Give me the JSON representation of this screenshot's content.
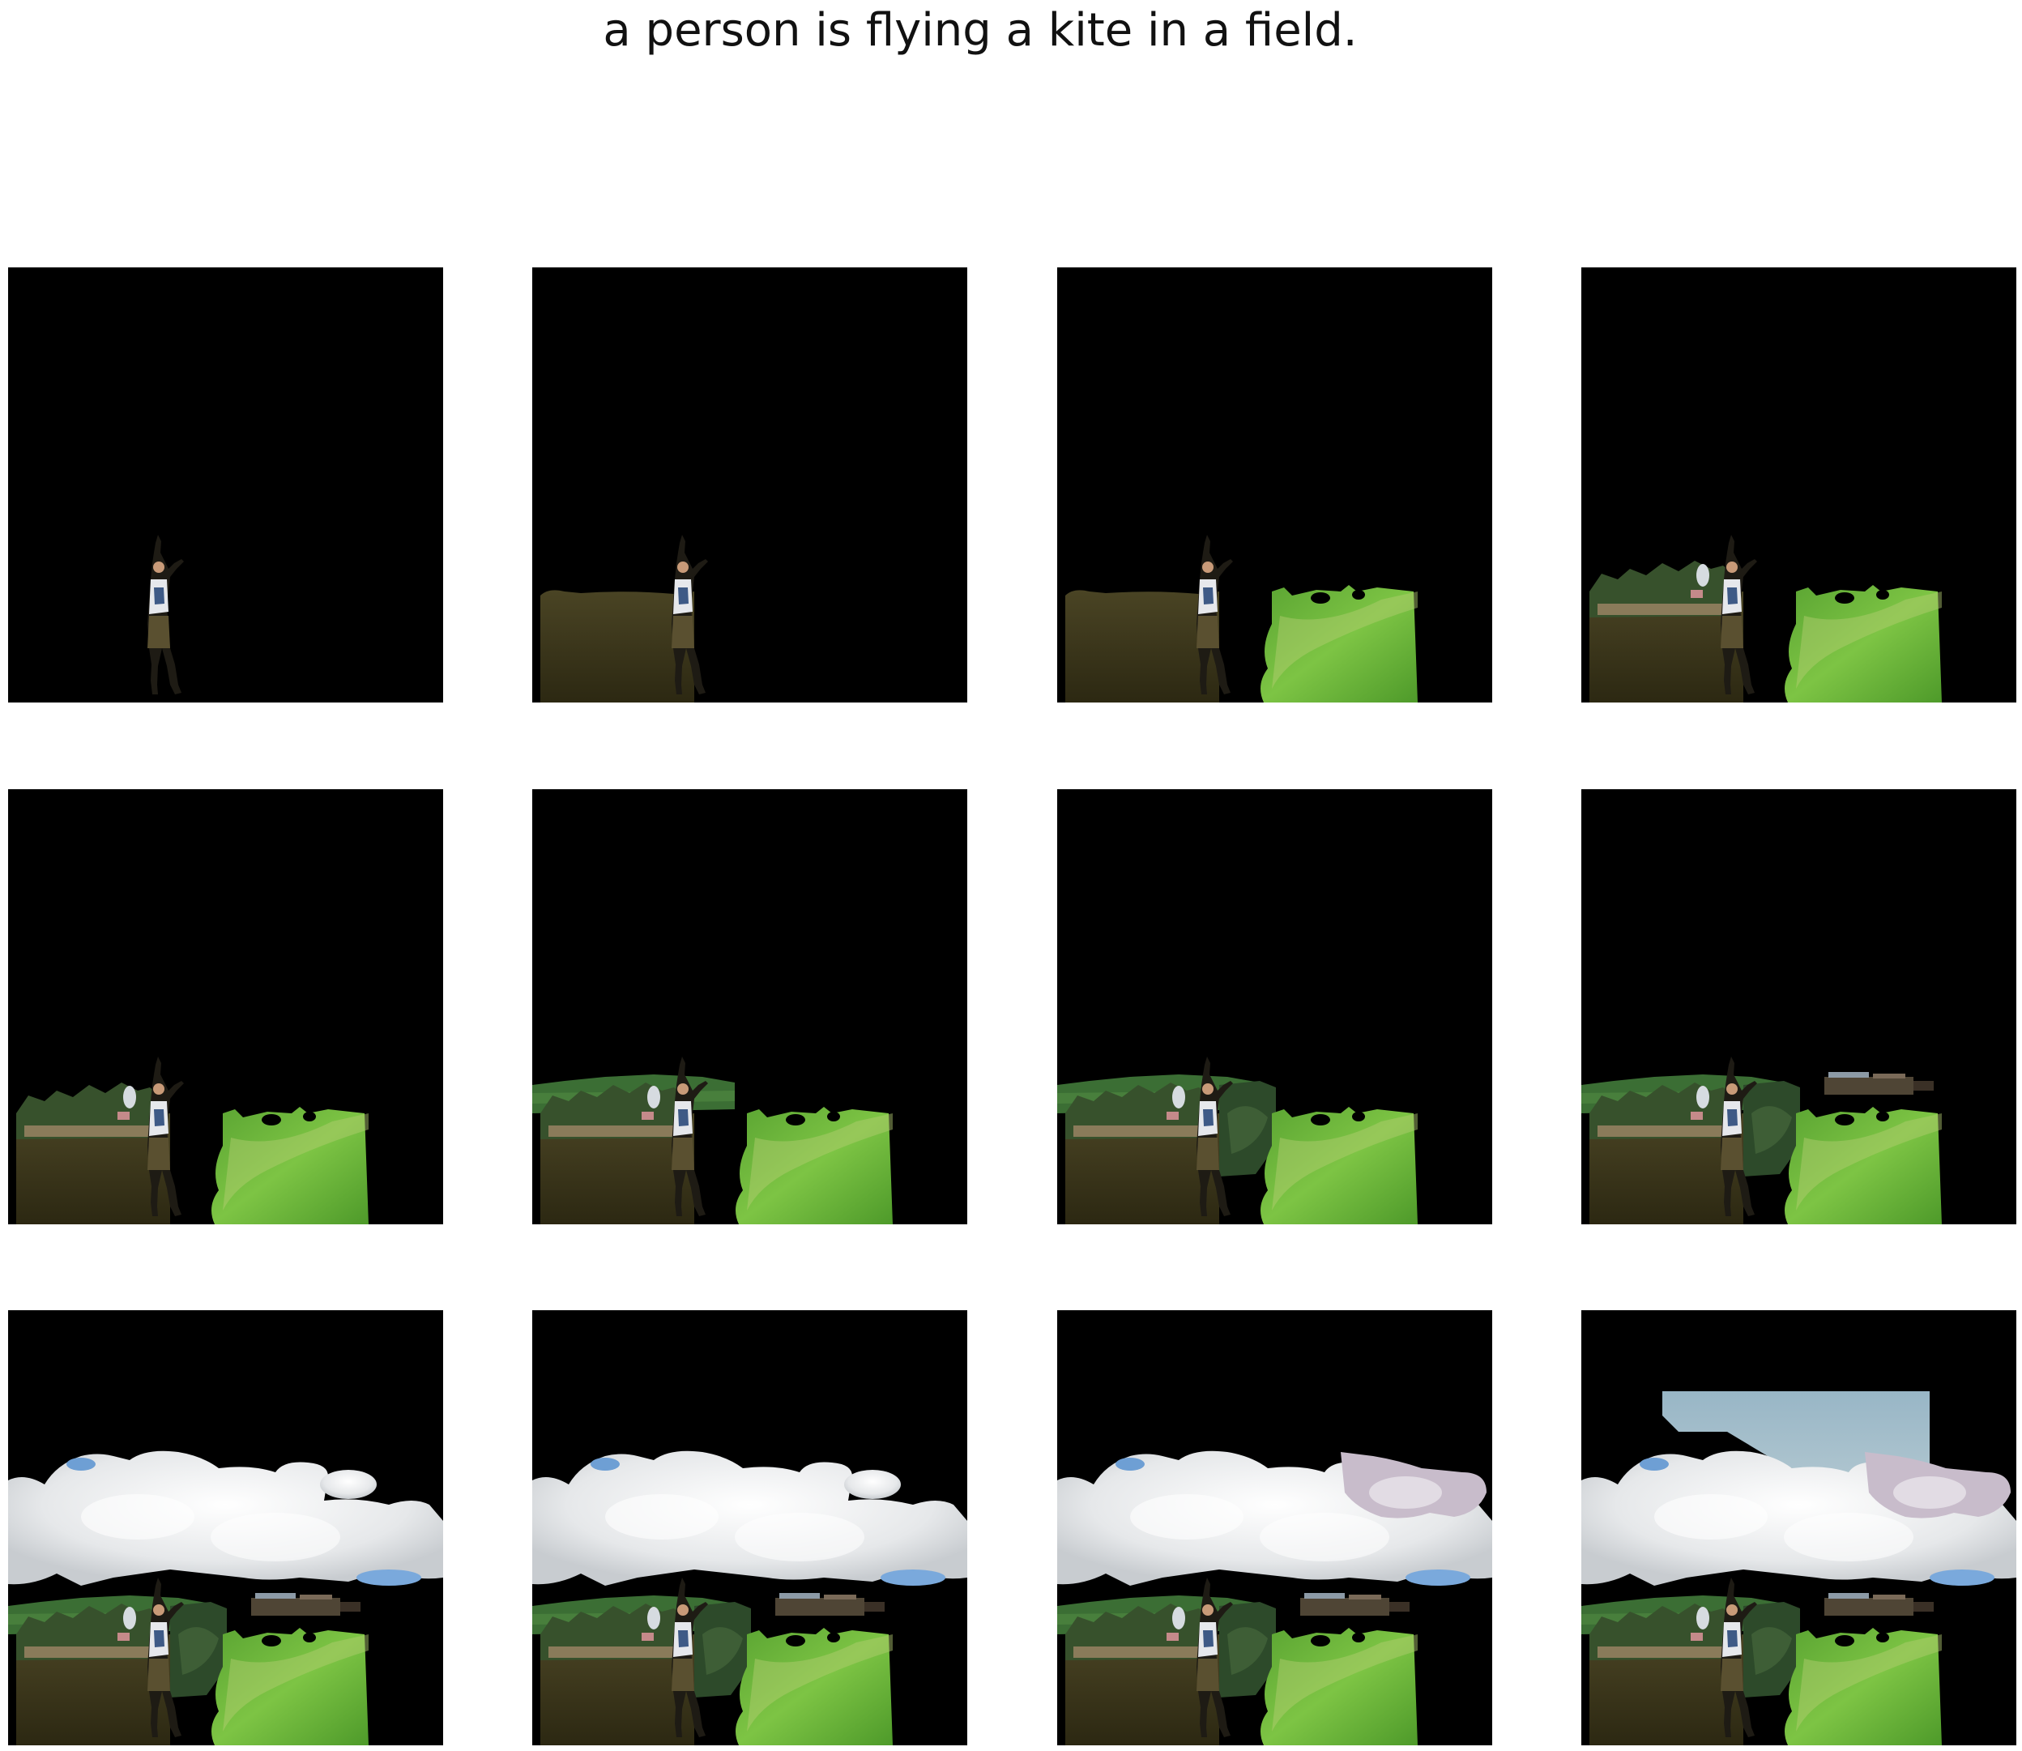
{
  "title": "a person is flying a kite in a field.",
  "grid": {
    "rows": 3,
    "cols": 4
  },
  "background_color": "#000000",
  "panels": [
    {
      "step": 1,
      "layers": [
        "person"
      ]
    },
    {
      "step": 2,
      "layers": [
        "dirt",
        "person"
      ]
    },
    {
      "step": 3,
      "layers": [
        "dirt",
        "grass-right",
        "person"
      ]
    },
    {
      "step": 4,
      "layers": [
        "dirt",
        "trees",
        "grass-right",
        "person"
      ]
    },
    {
      "step": 5,
      "layers": [
        "dirt",
        "trees",
        "grass-right",
        "person"
      ]
    },
    {
      "step": 6,
      "layers": [
        "grass-strip",
        "dirt",
        "trees",
        "grass-right",
        "person"
      ]
    },
    {
      "step": 7,
      "layers": [
        "grass-strip",
        "dirt",
        "trees",
        "bush",
        "grass-right",
        "person"
      ]
    },
    {
      "step": 8,
      "layers": [
        "grass-strip",
        "dirt",
        "trees",
        "bush",
        "grass-right",
        "buildings",
        "person"
      ]
    },
    {
      "step": 9,
      "layers": [
        "clouds",
        "grass-strip",
        "dirt",
        "trees",
        "bush",
        "grass-right",
        "buildings",
        "person"
      ]
    },
    {
      "step": 10,
      "layers": [
        "clouds",
        "grass-strip",
        "dirt",
        "trees",
        "bush",
        "grass-right",
        "buildings",
        "person"
      ]
    },
    {
      "step": 11,
      "layers": [
        "clouds",
        "pink-cloud",
        "grass-strip",
        "dirt",
        "trees",
        "bush",
        "grass-right",
        "buildings",
        "person"
      ]
    },
    {
      "step": 12,
      "layers": [
        "sky",
        "clouds",
        "pink-cloud",
        "grass-strip",
        "dirt",
        "trees",
        "bush",
        "grass-right",
        "buildings",
        "person"
      ]
    }
  ]
}
